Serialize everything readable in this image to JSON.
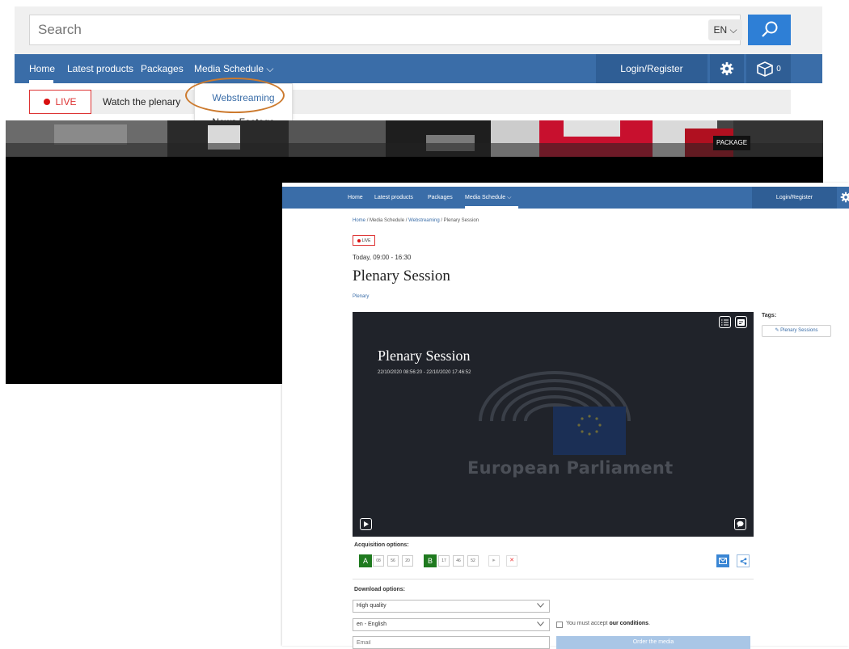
{
  "top": {
    "search_placeholder": "Search",
    "language": "EN",
    "nav": [
      "Home",
      "Latest products",
      "Packages",
      "Media Schedule"
    ],
    "login": "Login/Register",
    "cart_count": "0",
    "live_label": "LIVE",
    "watch_label": "Watch the plenary",
    "dropdown": [
      "Webstreaming",
      "News Footage"
    ],
    "photo_label": "PACKAGE"
  },
  "detail": {
    "nav": [
      "Home",
      "Latest products",
      "Packages",
      "Media Schedule"
    ],
    "login": "Login/Register",
    "breadcrumb": {
      "home": "Home",
      "schedule": "Media Schedule",
      "webstreaming": "Webstreaming",
      "current": "Plenary Session",
      "sep": "/"
    },
    "live_label": "LIVE",
    "time": "Today, 09:00 - 16:30",
    "title": "Plenary Session",
    "category": "Plenary",
    "video": {
      "title": "Plenary Session",
      "dates": "22/10/2020 08:56:20 - 22/10/2020 17:46:52",
      "logo_text": "European Parliament"
    },
    "tags_label": "Tags:",
    "tag": "Plenary Sessions",
    "acquisition_label": "Acquisition options:",
    "tc_a": {
      "letter": "A",
      "h": "08",
      "m": "56",
      "s": "20"
    },
    "tc_b": {
      "letter": "B",
      "h": "17",
      "m": "46",
      "s": "52"
    },
    "download_label": "Download options:",
    "quality": "High quality",
    "language": "en - English",
    "accept_prefix": "You must accept",
    "accept_link": "our conditions",
    "accept_suffix": ".",
    "email_placeholder": "Email",
    "order_label": "Order the media"
  },
  "colors": {
    "nav_blue": "#3a6da8",
    "accent_blue": "#2e7fd6",
    "live_red": "#d91010",
    "timecode_green": "#1f7a1f",
    "highlight_orange": "#cc7a2e"
  }
}
